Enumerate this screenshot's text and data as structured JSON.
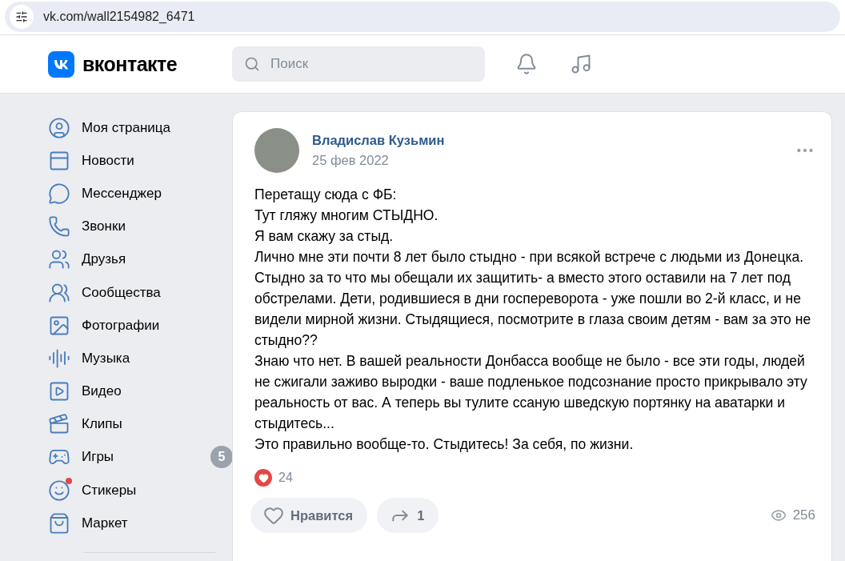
{
  "browser": {
    "url": "vk.com/wall2154982_6471"
  },
  "header": {
    "logo_text": "вконтакте",
    "search": {
      "placeholder": "Поиск"
    }
  },
  "sidebar": {
    "items": [
      {
        "label": "Моя страница",
        "dot": false
      },
      {
        "label": "Новости",
        "dot": false
      },
      {
        "label": "Мессенджер",
        "dot": false
      },
      {
        "label": "Звонки",
        "dot": false
      },
      {
        "label": "Друзья",
        "dot": false
      },
      {
        "label": "Сообщества",
        "dot": false
      },
      {
        "label": "Фотографии",
        "dot": false
      },
      {
        "label": "Музыка",
        "dot": false
      },
      {
        "label": "Видео",
        "dot": false
      },
      {
        "label": "Клипы",
        "dot": false
      },
      {
        "label": "Игры",
        "dot": false,
        "badge": "5"
      },
      {
        "label": "Стикеры",
        "dot": true
      },
      {
        "label": "Маркет",
        "dot": false
      }
    ]
  },
  "post": {
    "author": "Владислав Кузьмин",
    "date": "25 фев 2022",
    "paragraphs": [
      "Перетащу сюда с ФБ:",
      "Тут гляжу многим СТЫДНО.",
      "Я вам скажу за стыд.",
      "Лично мне эти почти 8 лет было стыдно - при всякой встрече с людьми из Донецка.",
      "Стыдно за то что мы обещали их защитить- а вместо этого оставили на 7 лет под обстрелами. Дети, родившиеся в дни госпереворота - уже пошли во 2-й класс, и не видели мирной жизни. Стыдящиеся, посмотрите в глаза своим детям - вам за это не стыдно??",
      "Знаю что нет. В вашей реальности Донбасса вообще не было - все эти годы, людей не сжигали заживо выродки - ваше подленькое подсознание просто прикрывало эту реальность от вас. А теперь вы тулите ссаную шведскую портянку на аватарки и стыдитесь...",
      "Это правильно вообще-то. Стыдитесь! За себя, по жизни."
    ],
    "reactions_count": "24",
    "like_button": {
      "label": "Нравится",
      "liked": false
    },
    "share_button": {
      "count": "1"
    },
    "views": "256"
  }
}
